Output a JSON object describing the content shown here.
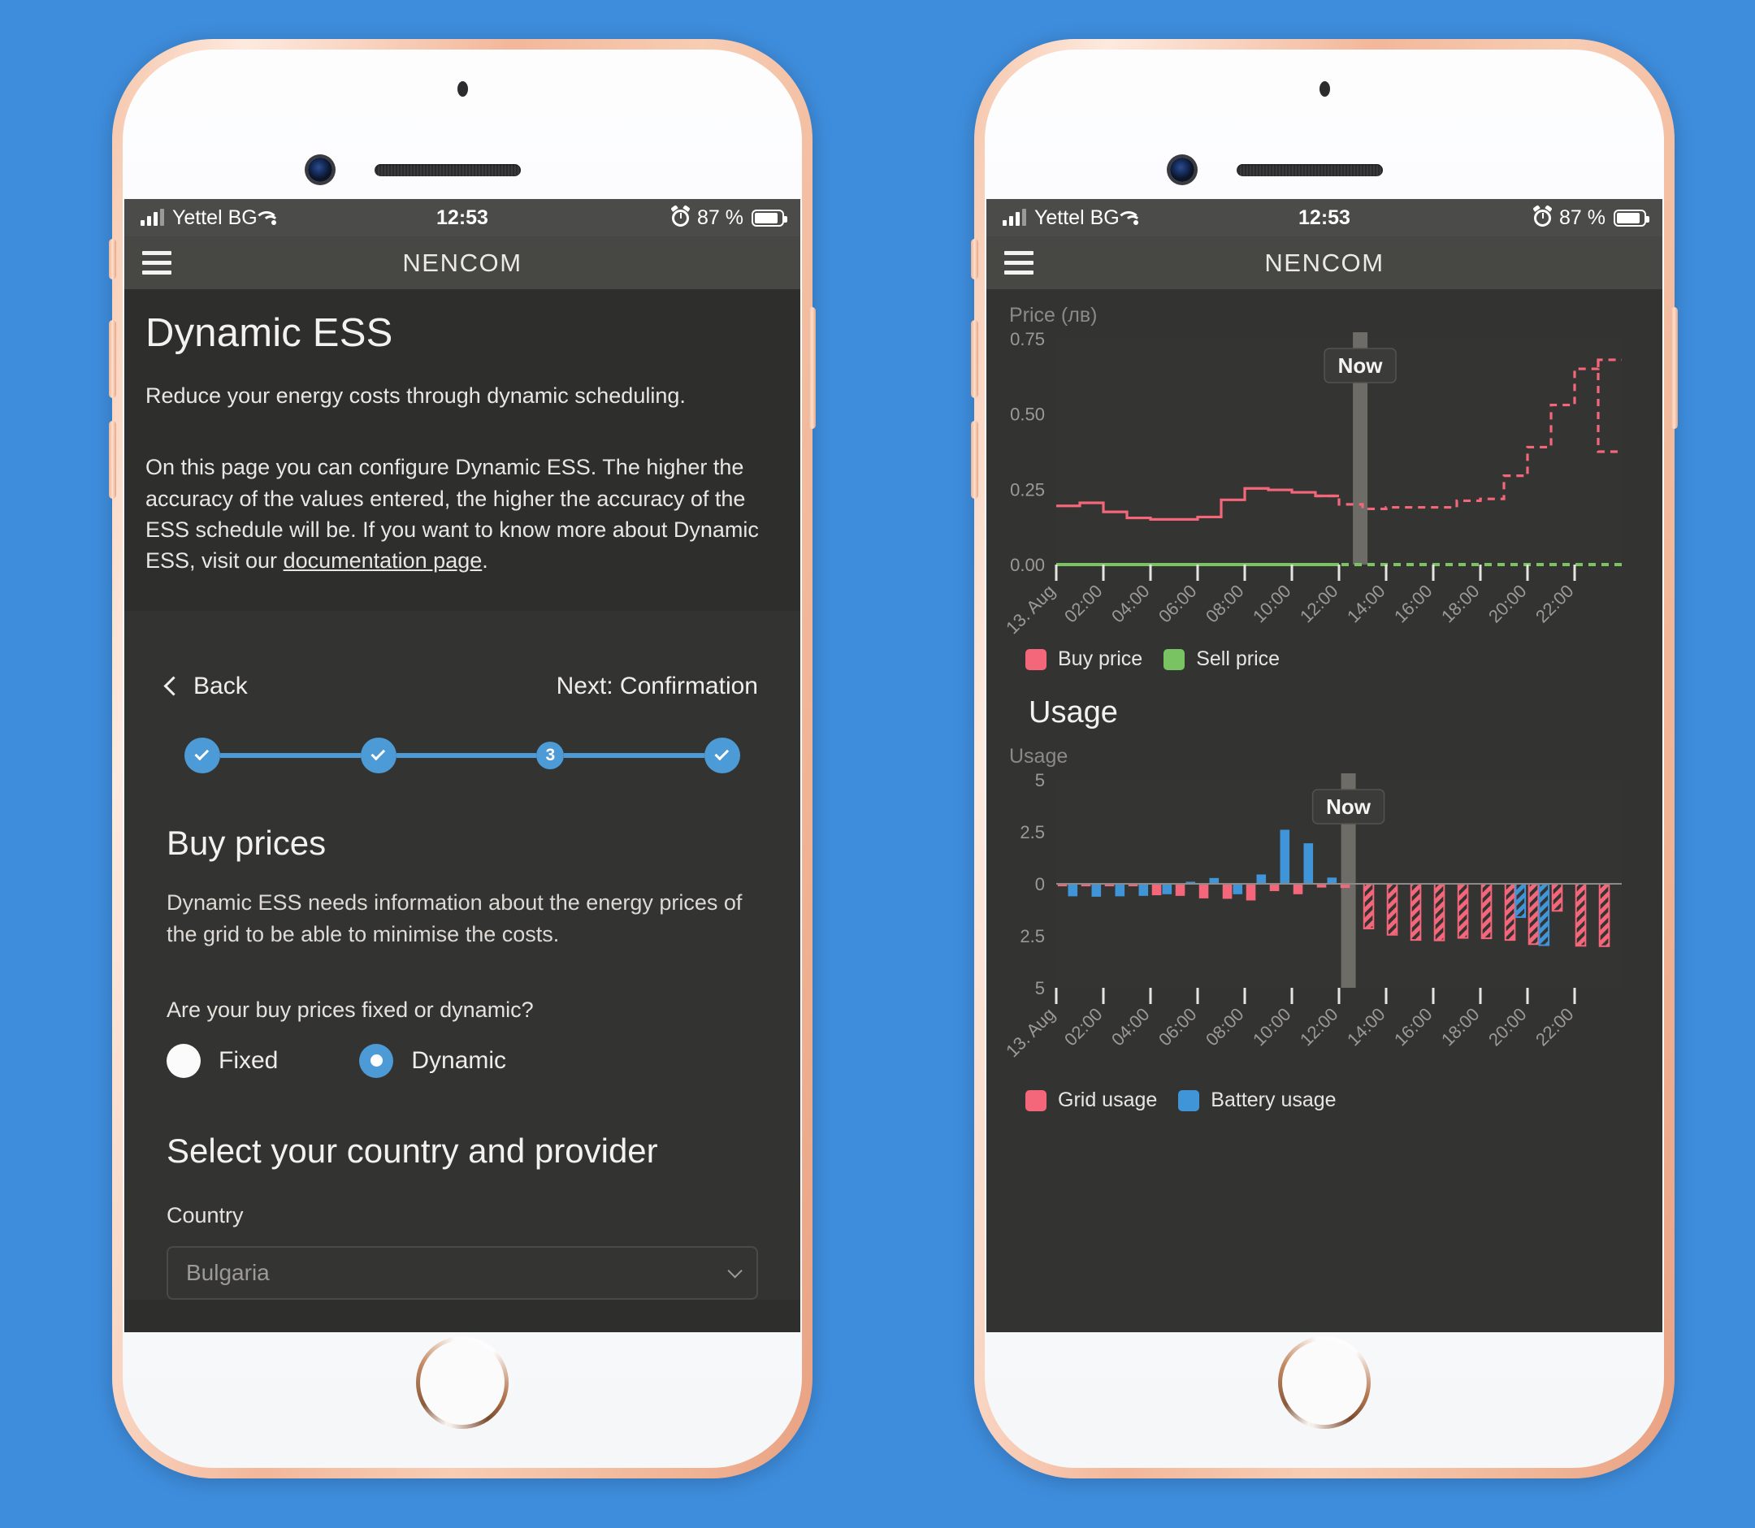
{
  "statusbar": {
    "carrier": "Yettel BG",
    "time": "12:53",
    "battery_percent": "87 %",
    "signal_icon": "cellular-signal-icon",
    "wifi_icon": "wifi-icon",
    "alarm_icon": "alarm-clock-icon",
    "battery_icon": "battery-icon"
  },
  "navbar": {
    "menu_icon": "hamburger-menu-icon",
    "title": "NENCOM"
  },
  "left_screen": {
    "page_title": "Dynamic ESS",
    "intro_line1": "Reduce your energy costs through dynamic scheduling.",
    "intro_line2_pre": "On this page you can configure Dynamic ESS. The higher the accuracy of the values entered, the higher the accuracy of the ESS schedule will be. If you want to know more about Dynamic ESS, visit our ",
    "intro_link": "documentation page",
    "intro_line2_post": ".",
    "back_label": "Back",
    "next_label": "Next: Confirmation",
    "stepper": {
      "steps": [
        {
          "label": "✓",
          "state": "done"
        },
        {
          "label": "✓",
          "state": "done"
        },
        {
          "label": "3",
          "state": "current"
        },
        {
          "label": "✓",
          "state": "done"
        }
      ],
      "accent_color": "#4c9ad6"
    },
    "buy_prices": {
      "heading": "Buy prices",
      "body": "Dynamic ESS needs information about the energy prices of the grid to be able to minimise the costs.",
      "question": "Are your buy prices fixed or dynamic?",
      "options": [
        {
          "label": "Fixed",
          "selected": false
        },
        {
          "label": "Dynamic",
          "selected": true
        }
      ]
    },
    "country_section": {
      "heading": "Select your country and provider",
      "country_label": "Country",
      "country_value": "Bulgaria",
      "chevron_icon": "chevron-down-icon"
    }
  },
  "right_screen": {
    "usage_heading": "Usage",
    "now_marker": "Now"
  },
  "chart_data": [
    {
      "type": "line",
      "title": "",
      "ylabel": "Price (лв)",
      "xlabel": "",
      "ylim": [
        0,
        0.75
      ],
      "ytick_labels": [
        "0.00",
        "0.25",
        "0.50",
        "0.75"
      ],
      "ytick_values": [
        0,
        0.25,
        0.5,
        0.75
      ],
      "xtick_labels": [
        "13. Aug",
        "02:00",
        "04:00",
        "06:00",
        "08:00",
        "10:00",
        "12:00",
        "14:00",
        "16:00",
        "18:00",
        "20:00",
        "22:00"
      ],
      "x": [
        0,
        1,
        2,
        3,
        4,
        5,
        6,
        7,
        8,
        9,
        10,
        11,
        12,
        13,
        14,
        15,
        16,
        17,
        18,
        19,
        20,
        21,
        22,
        23
      ],
      "step_style": "post",
      "now_index": 12.9,
      "grid": false,
      "legend_position": "bottom-left",
      "series": [
        {
          "name": "Buy price",
          "color": "#f4667a",
          "values": [
            0.195,
            0.205,
            0.175,
            0.155,
            0.15,
            0.15,
            0.158,
            0.215,
            0.253,
            0.248,
            0.24,
            0.228,
            0.2,
            0.185,
            0.19,
            0.19,
            0.19,
            0.212,
            0.218,
            0.295,
            0.39,
            0.53,
            0.65,
            0.68
          ],
          "solid_until_index": 12,
          "dashed_from_index": 12
        },
        {
          "name": "Sell price",
          "color": "#79c362",
          "values": [
            0,
            0,
            0,
            0,
            0,
            0,
            0,
            0,
            0,
            0,
            0,
            0,
            0,
            0,
            0,
            0,
            0,
            0,
            0,
            0,
            0,
            0,
            0,
            0
          ],
          "solid_until_index": 12,
          "dashed_from_index": 12
        }
      ],
      "tail_values": {
        "buy_price_last": 0.375
      }
    },
    {
      "type": "bar",
      "title": "Usage",
      "ylabel": "Usage",
      "xlabel": "",
      "ylim": [
        -5,
        5
      ],
      "ytick_labels": [
        "5",
        "2.5",
        "0",
        "2.5",
        "5"
      ],
      "ytick_values": [
        5,
        2.5,
        0,
        -2.5,
        -5
      ],
      "xtick_labels": [
        "13. Aug",
        "02:00",
        "04:00",
        "06:00",
        "08:00",
        "10:00",
        "12:00",
        "14:00",
        "16:00",
        "18:00",
        "20:00",
        "22:00"
      ],
      "now_index": 12.4,
      "grid": false,
      "legend_position": "bottom-left",
      "hatched_from_index": 13,
      "series": [
        {
          "name": "Grid usage",
          "color": "#f4667a",
          "values": [
            -0.12,
            -0.12,
            -0.12,
            -0.12,
            -0.55,
            -0.58,
            -0.7,
            -0.72,
            -0.8,
            -0.35,
            -0.5,
            -0.18,
            -0.2,
            -2.15,
            -2.45,
            -2.7,
            -2.72,
            -2.6,
            -2.62,
            -2.7,
            -2.9,
            -1.3,
            -2.98,
            -3.0
          ]
        },
        {
          "name": "Battery usage",
          "color": "#3f95d8",
          "values": [
            -0.6,
            -0.62,
            -0.6,
            -0.58,
            -0.5,
            0.1,
            0.28,
            -0.5,
            0.45,
            2.6,
            1.95,
            0.3,
            0.0,
            0.0,
            0.0,
            0.0,
            0.0,
            0.0,
            0.0,
            -1.6,
            -2.95,
            0.0,
            0.0,
            0.0
          ]
        }
      ]
    }
  ]
}
